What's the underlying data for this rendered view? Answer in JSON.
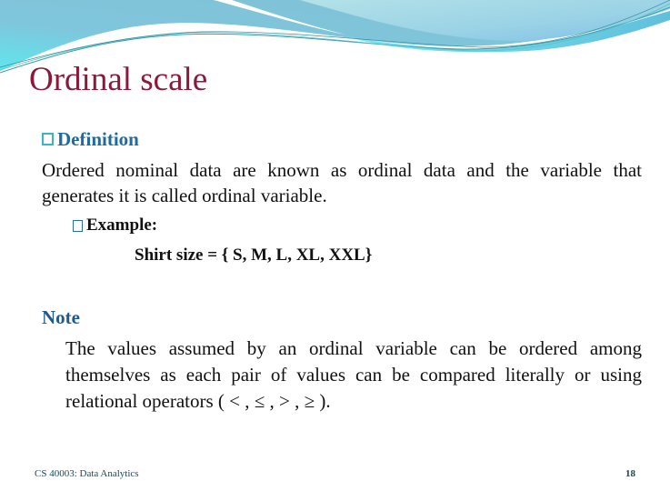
{
  "slide": {
    "title": "Ordinal scale",
    "definition": {
      "heading": "Definition",
      "bullet_icon": "square-bullet-icon",
      "text": "Ordered nominal data are known as ordinal data and the variable that generates it is called ordinal variable."
    },
    "example": {
      "heading": "Example:",
      "bullet_icon": "square-bullet-icon",
      "text": "Shirt size = { S, M, L, XL, XXL}"
    },
    "note": {
      "heading": "Note",
      "text": "The values assumed by an ordinal variable can be ordered among themselves as each pair of values can be compared literally or using relational operators ( < , ≤ , > , ≥ )."
    },
    "footer": {
      "course": "CS 40003: Data Analytics",
      "page_number": "18"
    },
    "colors": {
      "title": "#8b1a3a",
      "heading": "#1f6aa0",
      "note_heading": "#1f5a8a",
      "bullet": "#3fb3c6",
      "footer": "#1a4a5a",
      "wave_light": "#a8dfe8",
      "wave_mid": "#7fc3d8",
      "wave_cyan": "#5fe0ea"
    }
  }
}
